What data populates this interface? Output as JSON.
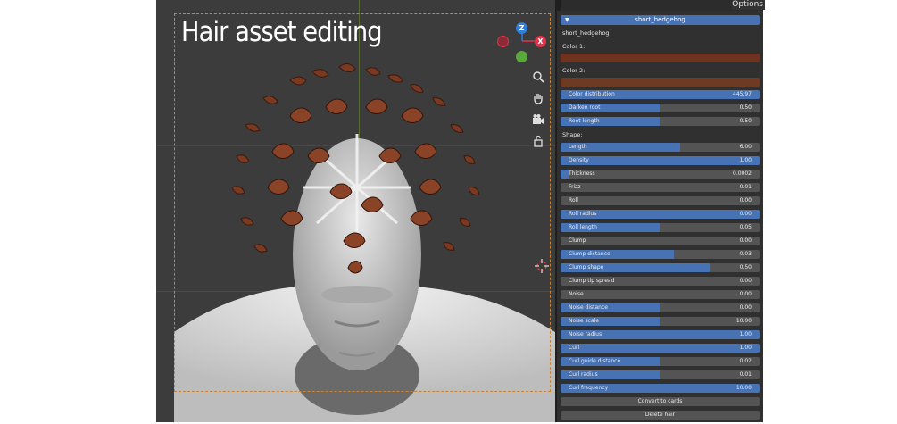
{
  "viewport": {
    "overlay_title": "Hair asset editing",
    "gizmo": {
      "z_label": "Z",
      "x_label": "X",
      "z_color": "#2f7fe0",
      "x_color": "#e0354a",
      "y_color": "#5aa93a"
    },
    "tools": [
      "zoom-icon",
      "hand-pan-icon",
      "camera-icon",
      "lock-icon"
    ]
  },
  "options_label": "Options",
  "panel": {
    "header": "short_hedgehog",
    "asset_name": "short_hedgehog",
    "color1_label": "Color 1:",
    "color1": "#6e3220",
    "color2_label": "Color 2:",
    "color2": "#6e3a22",
    "top_sliders": [
      {
        "name": "Color distribution",
        "value": "445.97",
        "fill": 1.0
      },
      {
        "name": "Darken root",
        "value": "0.50",
        "fill": 0.5
      },
      {
        "name": "Root length",
        "value": "0.50",
        "fill": 0.5
      }
    ],
    "shape_label": "Shape:",
    "shape_sliders": [
      {
        "name": "Length",
        "value": "6.00",
        "fill": 0.6
      },
      {
        "name": "Density",
        "value": "1.00",
        "fill": 1.0
      },
      {
        "name": "Thickness",
        "value": "0.0002",
        "fill": 0.04
      },
      {
        "name": "Frizz",
        "value": "0.01",
        "fill": 0.0
      },
      {
        "name": "Roll",
        "value": "0.00",
        "fill": 0.0
      },
      {
        "name": "Roll radius",
        "value": "0.00",
        "fill": 1.0
      },
      {
        "name": "Roll length",
        "value": "0.05",
        "fill": 0.5
      },
      {
        "name": "Clump",
        "value": "0.00",
        "fill": 0.0
      },
      {
        "name": "Clump distance",
        "value": "0.03",
        "fill": 0.57
      },
      {
        "name": "Clump shape",
        "value": "0.50",
        "fill": 0.75
      },
      {
        "name": "Clump tip spread",
        "value": "0.00",
        "fill": 0.0
      },
      {
        "name": "Noise",
        "value": "0.00",
        "fill": 0.0
      },
      {
        "name": "Noise distance",
        "value": "0.00",
        "fill": 0.5
      },
      {
        "name": "Noise scale",
        "value": "10.00",
        "fill": 0.5
      },
      {
        "name": "Noise radius",
        "value": "1.00",
        "fill": 1.0
      },
      {
        "name": "Curl",
        "value": "1.00",
        "fill": 1.0
      },
      {
        "name": "Curl guide distance",
        "value": "0.02",
        "fill": 0.5
      },
      {
        "name": "Curl radius",
        "value": "0.01",
        "fill": 0.5
      },
      {
        "name": "Curl frequency",
        "value": "10.00",
        "fill": 1.0
      }
    ],
    "buttons": [
      "Convert to cards",
      "Delete hair"
    ]
  }
}
